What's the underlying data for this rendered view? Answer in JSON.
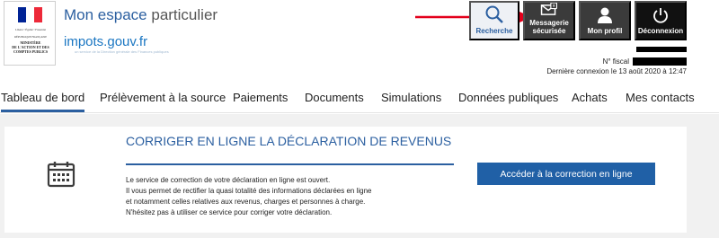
{
  "header": {
    "republic_logo": {
      "motto": "Liberté • Égalité • Fraternité",
      "republic": "RÉPUBLIQUE FRANÇAISE",
      "ministry": "MINISTÈRE\nDE L'ACTION ET DES\nCOMPTES PUBLICS"
    },
    "site_title_main": "Mon espace",
    "site_title_light": "particulier",
    "impots_logo": "impots.gouv.fr",
    "impots_tagline": "un service de la Direction générale des Finances publiques",
    "buttons": {
      "search": "Recherche",
      "secure_mail": "Messagerie sécurisée",
      "profile": "Mon profil",
      "logout": "Déconnexion"
    },
    "fiscal_label": "N° fiscal",
    "last_login": "Dernière connexion le 13 août 2020 à 12:47"
  },
  "nav": {
    "items": [
      {
        "label": "Tableau de bord",
        "active": true
      },
      {
        "label": "Prélèvement à la source"
      },
      {
        "label": "Paiements"
      },
      {
        "label": "Documents"
      },
      {
        "label": "Simulations"
      },
      {
        "label": "Données publiques"
      },
      {
        "label": "Achats"
      },
      {
        "label": "Mes contacts"
      }
    ]
  },
  "card": {
    "title": "CORRIGER EN LIGNE LA DÉCLARATION DE REVENUS",
    "lines": [
      "Le service de correction de votre déclaration en ligne est ouvert.",
      "Il vous permet de rectifier la quasi totalité des informations déclarées en ligne",
      "et notamment celles relatives aux revenus, charges et personnes à charge.",
      "N'hésitez pas à utiliser ce service pour corriger votre déclaration."
    ],
    "cta": "Accéder à la correction en ligne"
  },
  "colors": {
    "brand_blue": "#2b5fa0",
    "cta_blue": "#2060a6",
    "dark_button": "#3b3b3b",
    "annotation_red": "#e3001b"
  },
  "icons": [
    "marianne-flag",
    "search-icon",
    "envelope-icon",
    "user-icon",
    "power-icon",
    "calendar-icon",
    "red-arrow-annotation"
  ]
}
